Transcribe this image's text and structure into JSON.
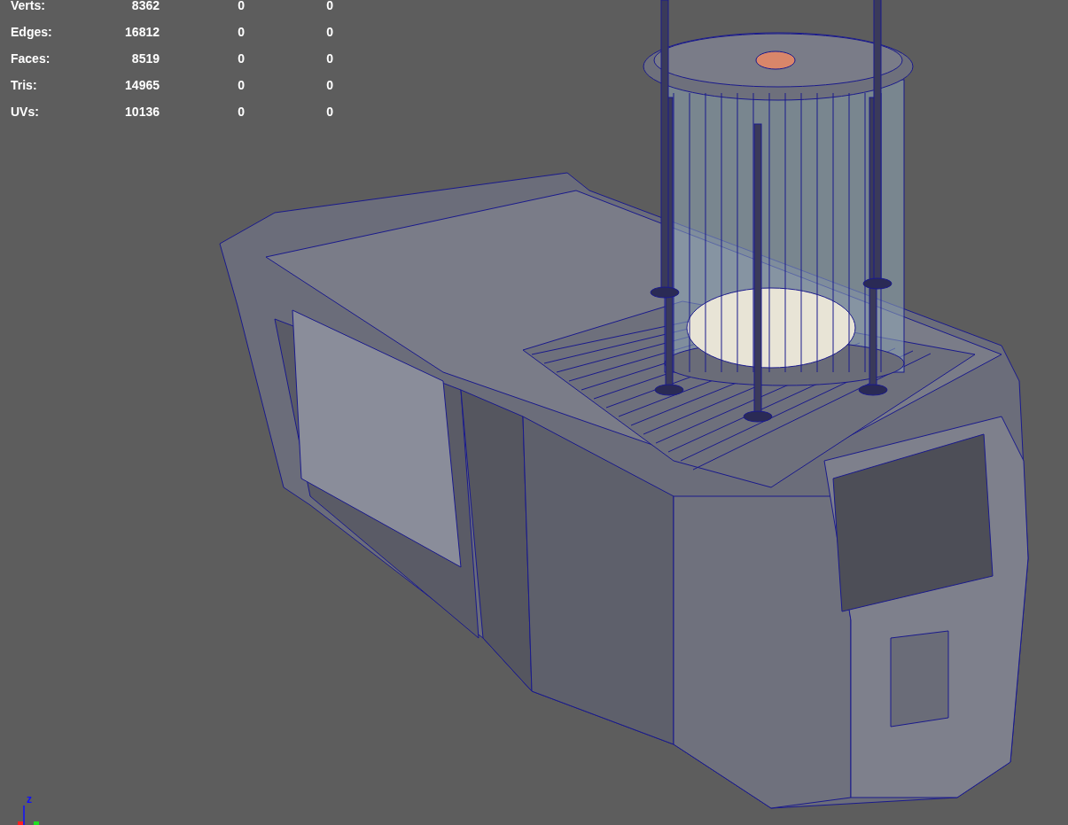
{
  "hud_stats": [
    {
      "label": "Verts:",
      "value": "8362",
      "column_3": "0",
      "column_4": "0"
    },
    {
      "label": "Edges:",
      "value": "16812",
      "column_3": "0",
      "column_4": "0"
    },
    {
      "label": "Faces:",
      "value": "8519",
      "column_3": "0",
      "column_4": "0"
    },
    {
      "label": "Tris:",
      "value": "14965",
      "column_3": "0",
      "column_4": "0"
    },
    {
      "label": "UVs:",
      "value": "10136",
      "column_3": "0",
      "column_4": "0"
    }
  ],
  "axis_gizmo": {
    "label": "z"
  }
}
